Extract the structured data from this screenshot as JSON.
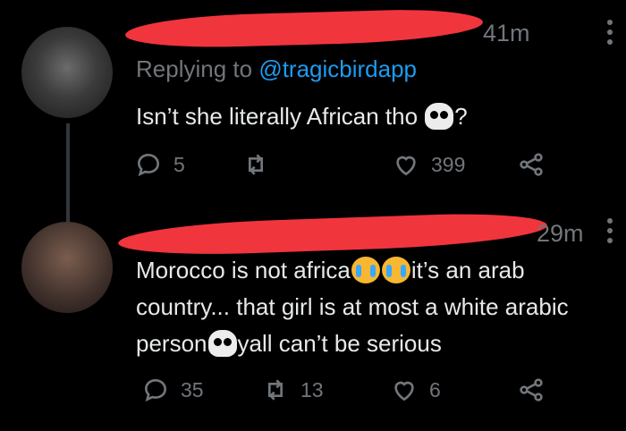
{
  "tweets": [
    {
      "time": "41m",
      "replying_prefix": "Replying to ",
      "replying_handle": "@tragicbirdapp",
      "text_before": "Isn’t she literally African tho ",
      "text_after": "?",
      "stats": {
        "replies": "5",
        "retweets": "",
        "likes": "399"
      }
    },
    {
      "time": "29m",
      "text_parts": [
        "Morocco is not africa",
        "it’s an arab country... that girl is at most a white arabic person",
        "yall can’t be serious"
      ],
      "stats": {
        "replies": "35",
        "retweets": "13",
        "likes": "6"
      }
    }
  ],
  "icons": {
    "reply": "reply-icon",
    "retweet": "retweet-icon",
    "like": "heart-icon",
    "share": "share-icon",
    "skull": "skull-emoji",
    "crying": "loudly-crying-emoji"
  },
  "colors": {
    "background": "#000000",
    "text": "#e7e9ea",
    "muted": "#71767b",
    "link": "#1d9bf0",
    "redaction": "#f0353d"
  }
}
